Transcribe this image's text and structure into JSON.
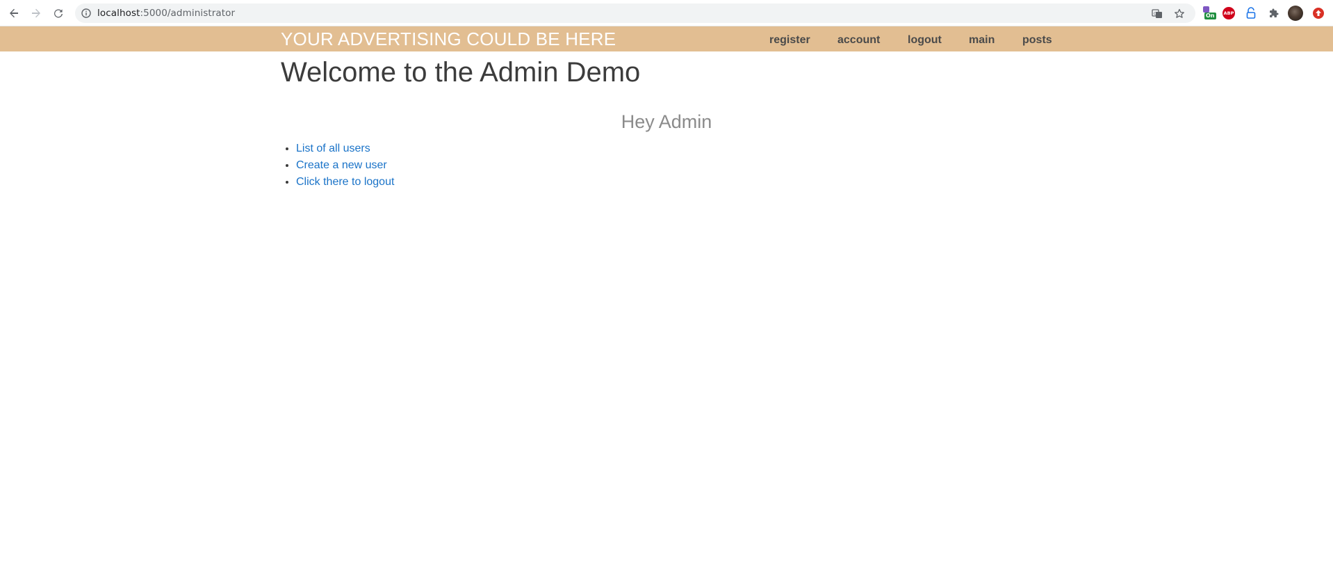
{
  "browser": {
    "url_host": "localhost",
    "url_rest": ":5000/administrator",
    "icons": {
      "back": "back-arrow-icon",
      "forward": "forward-arrow-icon",
      "reload": "reload-icon",
      "site_info": "info-icon",
      "translate": "translate-icon",
      "bookmark": "star-icon",
      "extensions": "puzzle-icon"
    },
    "extensions": {
      "first_badge": "On",
      "adblock_label": "ABP"
    }
  },
  "header": {
    "background_color": "#e2be92",
    "brand": "YOUR ADVERTISING COULD BE HERE",
    "nav": [
      {
        "label": "register"
      },
      {
        "label": "account"
      },
      {
        "label": "logout"
      },
      {
        "label": "main"
      },
      {
        "label": "posts"
      }
    ]
  },
  "main": {
    "title": "Welcome to the Admin Demo",
    "greeting": "Hey Admin",
    "links": [
      {
        "label": "List of all users"
      },
      {
        "label": "Create a new user"
      },
      {
        "label": "Click there to logout"
      }
    ],
    "link_color": "#1a73c8"
  }
}
